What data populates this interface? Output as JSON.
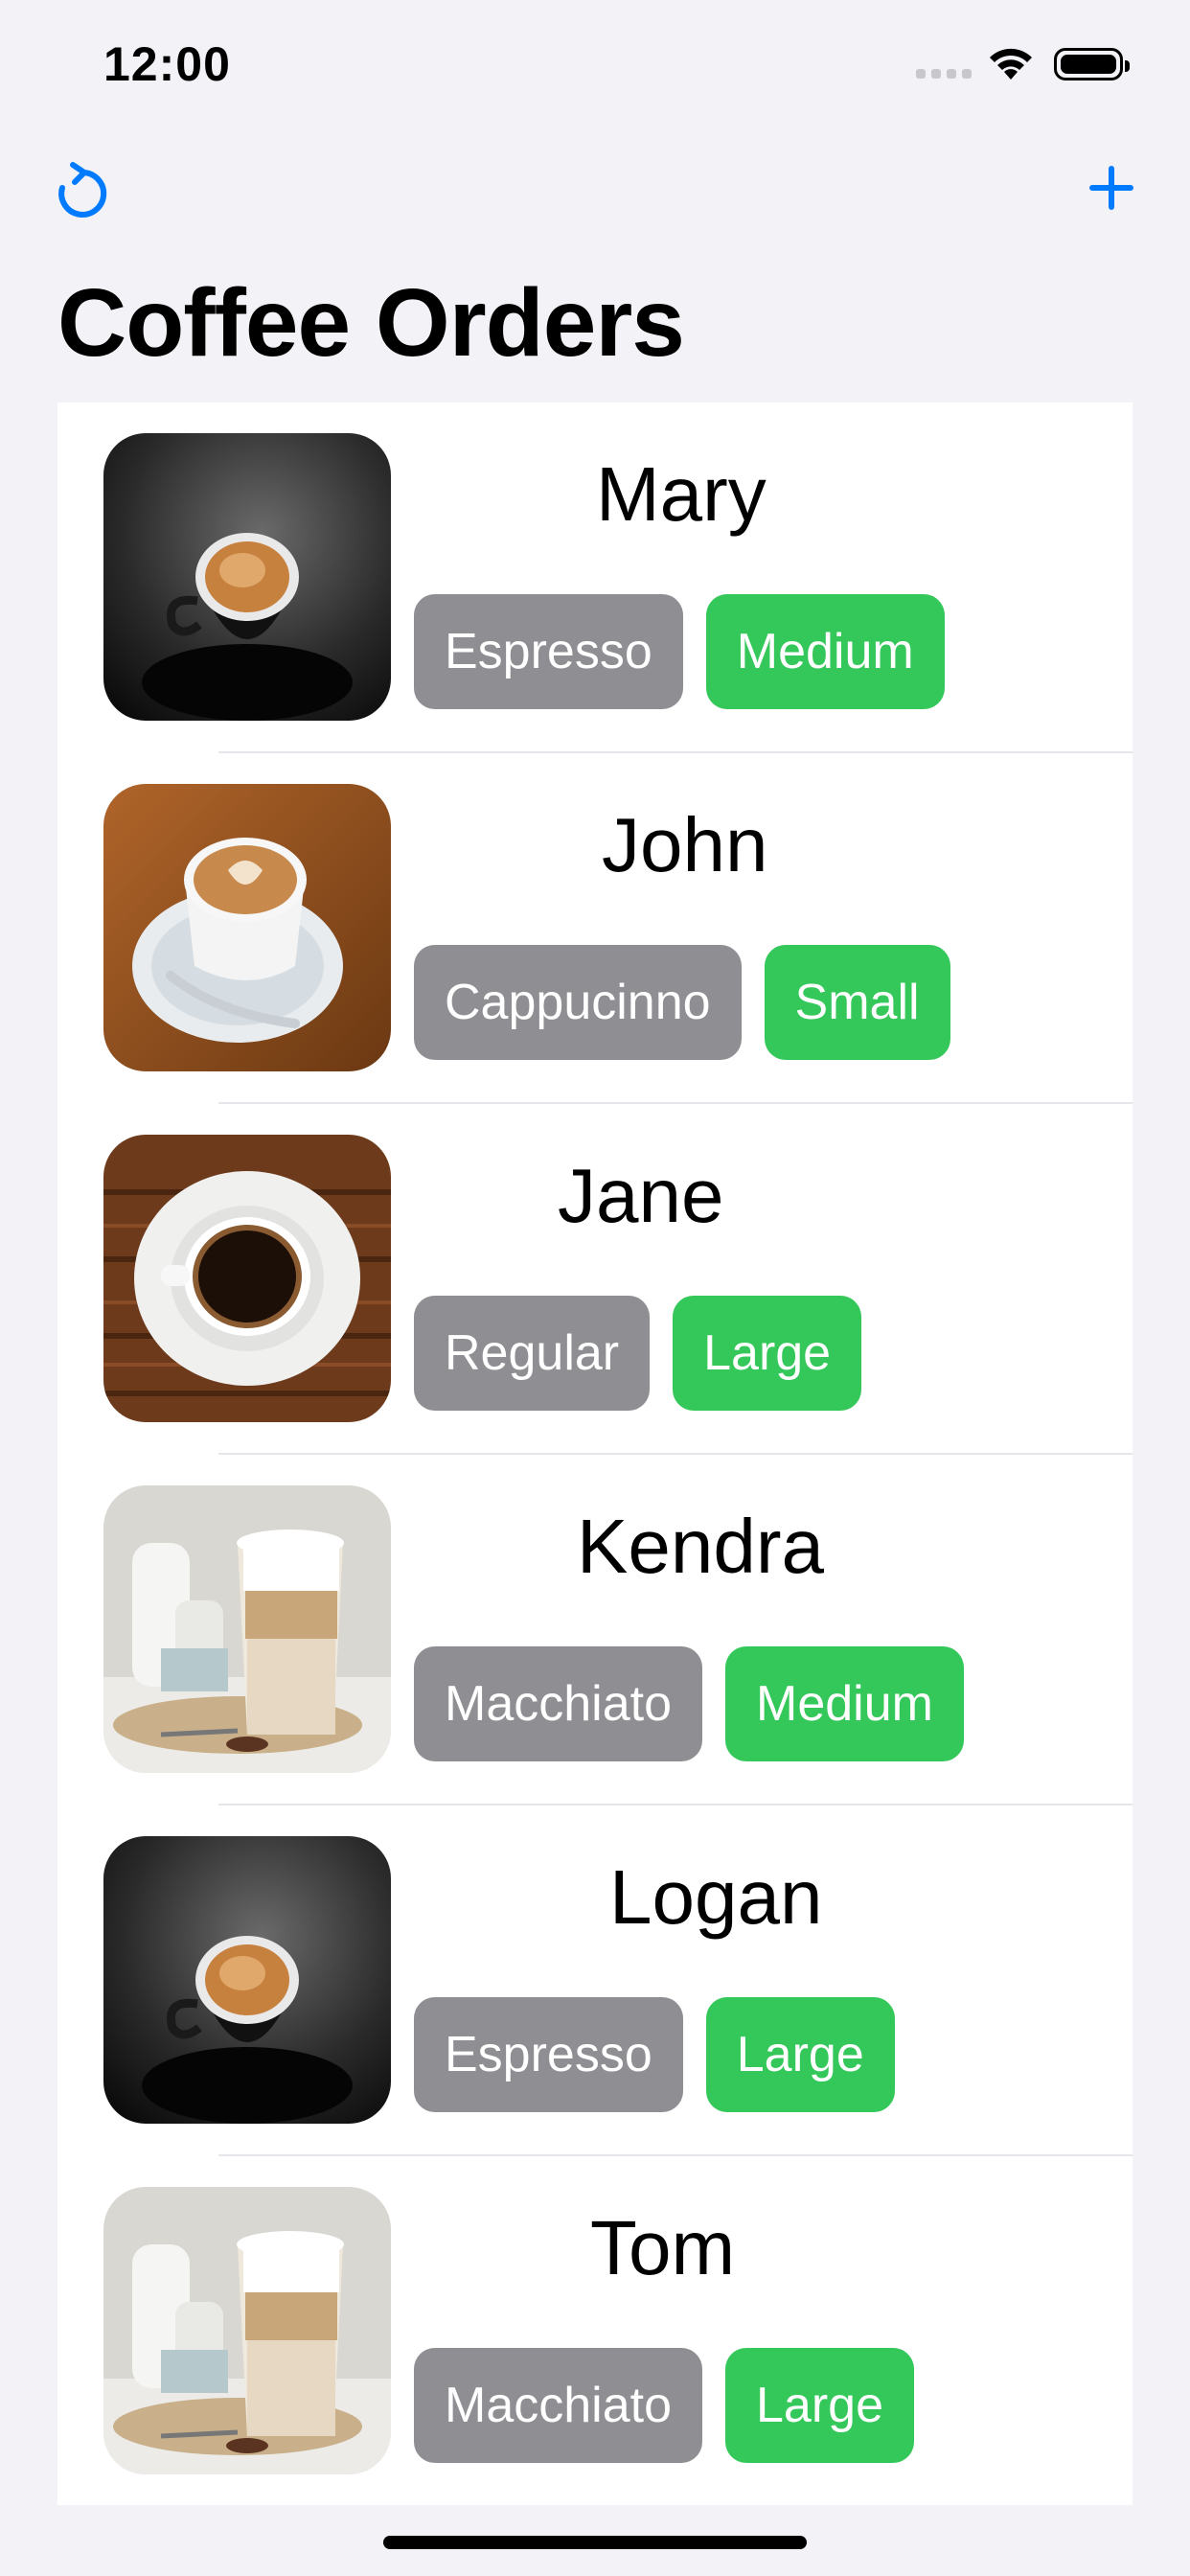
{
  "status_bar": {
    "time": "12:00"
  },
  "nav": {
    "refresh_icon": "refresh-icon",
    "add_icon": "plus-icon",
    "accent_color": "#007aff"
  },
  "page": {
    "title": "Coffee Orders"
  },
  "colors": {
    "type_badge": "#8e8e93",
    "size_badge": "#34c759"
  },
  "orders": [
    {
      "name": "Mary",
      "type": "Espresso",
      "size": "Medium",
      "image": "espresso-cup-photo"
    },
    {
      "name": "John",
      "type": "Cappucinno",
      "size": "Small",
      "image": "cappuccino-cup-photo"
    },
    {
      "name": "Jane",
      "type": "Regular",
      "size": "Large",
      "image": "black-coffee-cup-photo"
    },
    {
      "name": "Kendra",
      "type": "Macchiato",
      "size": "Medium",
      "image": "latte-macchiato-glass-photo"
    },
    {
      "name": "Logan",
      "type": "Espresso",
      "size": "Large",
      "image": "espresso-cup-photo"
    },
    {
      "name": "Tom",
      "type": "Macchiato",
      "size": "Large",
      "image": "latte-macchiato-glass-photo"
    }
  ]
}
